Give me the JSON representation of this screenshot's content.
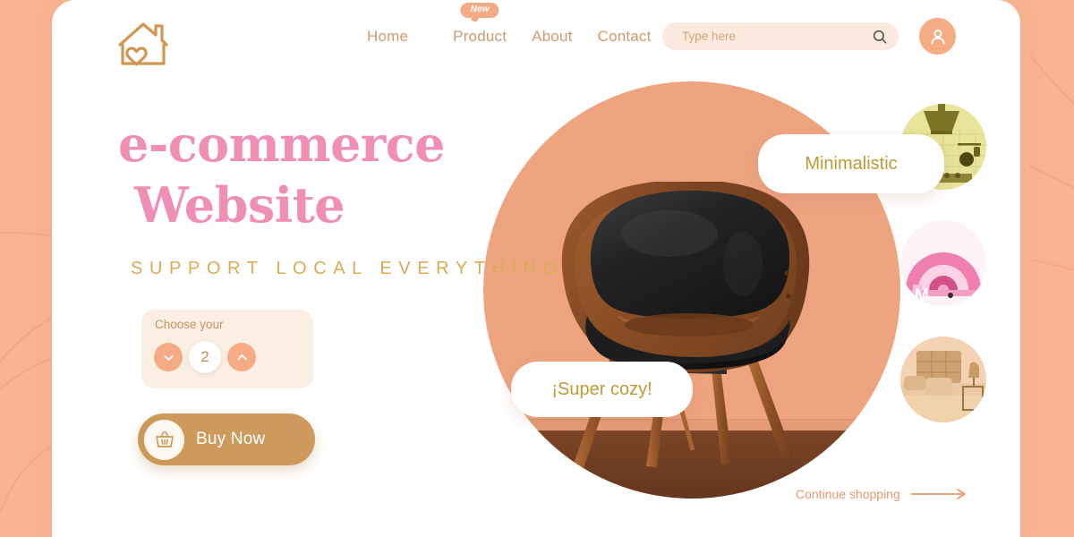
{
  "theme": {
    "background": "#f9b491",
    "card": "#ffffff",
    "accent_salmon": "#efa480",
    "accent_gold": "#cd9a5b",
    "accent_pink": "#ef8fb4",
    "tagline_gold": "#d8ac55",
    "pill_text_gold": "#bf9b34",
    "panel_cream": "#fbeee2",
    "search_bg": "#fbeadd"
  },
  "header": {
    "logo_name": "house-heart-logo",
    "nav": [
      {
        "label": "Home",
        "badge": null
      },
      {
        "label": "Product",
        "badge": "New"
      },
      {
        "label": "About",
        "badge": null
      },
      {
        "label": "Contact",
        "badge": null
      }
    ],
    "search": {
      "placeholder": "Type here",
      "value": "",
      "icon": "search-icon"
    },
    "avatar": {
      "icon": "user-icon"
    }
  },
  "hero": {
    "title_line1": "e-commerce",
    "title_line2": "Website",
    "tagline": "SUPPORT LOCAL EVERYTHING",
    "chooser": {
      "label": "Choose your",
      "quantity": "2",
      "decrement_icon": "chevron-down-icon",
      "increment_icon": "chevron-up-icon"
    },
    "buy_button": {
      "label": "Buy Now",
      "icon": "shopping-basket-icon"
    }
  },
  "visual": {
    "product_image_alt": "black-leather-wood-chair",
    "pills": [
      {
        "label": "Minimalistic",
        "name": "pill-minimalistic"
      },
      {
        "label": "¡Super cozy!",
        "name": "pill-super-cozy"
      }
    ]
  },
  "thumbnails": [
    {
      "name": "thumbnail-kitchen",
      "alt": "yellow-tinted-kitchen-range-hood"
    },
    {
      "name": "thumbnail-rainbow-decor",
      "alt": "pink-rainbow-arch-decor"
    },
    {
      "name": "thumbnail-bedroom",
      "alt": "peach-tinted-bedroom"
    }
  ],
  "footer": {
    "continue_label": "Continue shopping",
    "arrow_icon": "arrow-right-icon"
  }
}
